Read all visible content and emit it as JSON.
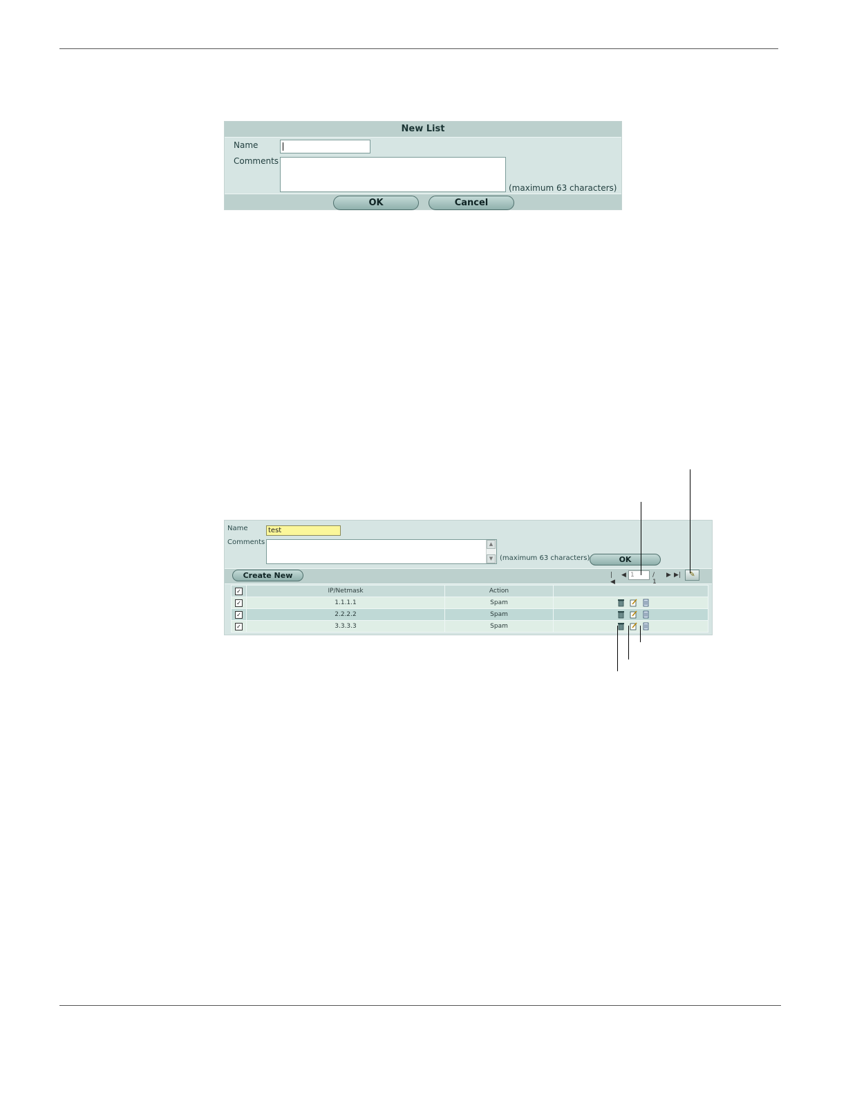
{
  "new_list_dialog": {
    "title": "New List",
    "name_label": "Name",
    "comments_label": "Comments",
    "comments_hint": "(maximum 63 characters)",
    "ok_label": "OK",
    "cancel_label": "Cancel"
  },
  "edit_list_dialog": {
    "name_label": "Name",
    "name_value": "test",
    "comments_label": "Comments",
    "comments_hint": "(maximum 63 characters)",
    "ok_label": "OK",
    "create_new_label": "Create New",
    "pager": {
      "current_page": "1",
      "total_pages": "/ 1"
    },
    "table": {
      "columns": [
        "IP/Netmask",
        "Action"
      ],
      "rows": [
        {
          "ip": "1.1.1.1",
          "action": "Spam"
        },
        {
          "ip": "2.2.2.2",
          "action": "Spam"
        },
        {
          "ip": "3.3.3.3",
          "action": "Spam"
        }
      ]
    },
    "icons": {
      "delete": "trash-icon",
      "edit": "edit-icon",
      "insert": "insert-icon",
      "column_settings": "column-settings-icon",
      "first_page": "first-page-icon",
      "prev_page": "prev-page-icon",
      "next_page": "next-page-icon",
      "last_page": "last-page-icon"
    }
  }
}
